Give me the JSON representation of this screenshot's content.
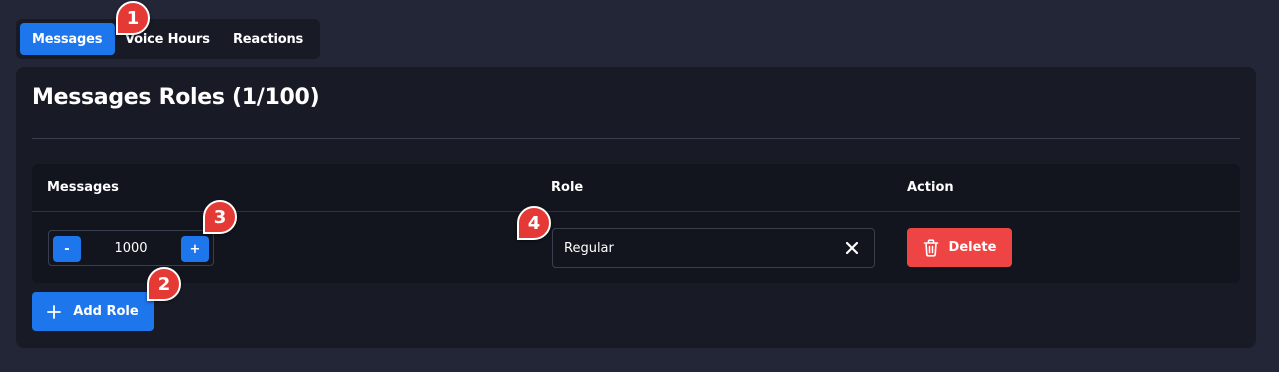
{
  "tabs": [
    {
      "label": "Messages",
      "active": true
    },
    {
      "label": "Voice Hours",
      "active": false
    },
    {
      "label": "Reactions",
      "active": false
    }
  ],
  "panel": {
    "title": "Messages Roles (1/100)"
  },
  "table": {
    "headers": {
      "messages": "Messages",
      "role": "Role",
      "action": "Action"
    },
    "rows": [
      {
        "stepper": {
          "minus": "-",
          "value": "1000",
          "plus": "+"
        },
        "role": "Regular",
        "delete_label": "Delete"
      }
    ]
  },
  "add_role_label": "Add Role",
  "markers": [
    "1",
    "2",
    "3",
    "4"
  ],
  "colors": {
    "background": "#222637",
    "panel": "#181b26",
    "accent": "#1e76ec",
    "danger": "#ef4444",
    "marker": "#e53935"
  },
  "icons": {
    "clear": "close-icon",
    "delete": "trash-icon",
    "add": "plus-icon"
  }
}
